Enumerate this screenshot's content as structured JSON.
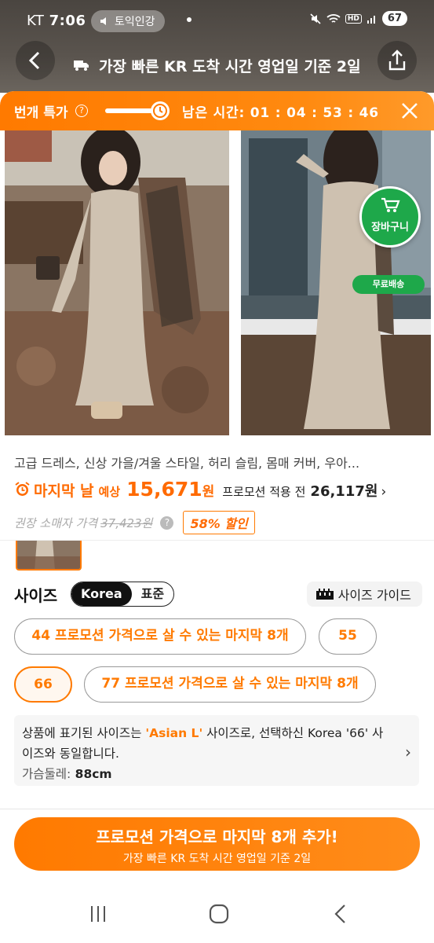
{
  "status_bar": {
    "carrier": "KT",
    "time": "7:06",
    "media_label": "토익인강",
    "hd_label": "HD",
    "battery": "67"
  },
  "banner": {
    "text": "가장 빠른 KR 도착 시간 영업일 기준 2일"
  },
  "promo": {
    "title": "번개 특가",
    "remaining_label": "남은 시간:",
    "remaining_time": "01 : 04 : 53 : 46",
    "progress_fraction": 0.85
  },
  "gallery": {
    "cart_label": "장바구니",
    "free_shipping_label": "무료배송"
  },
  "product": {
    "title": "고급 드레스, 신상 가을/겨울 스타일, 허리 슬림, 몸매 커버, 우아...",
    "last_day_label": "마지막 날",
    "expected_label": "예상",
    "price": "15,671",
    "currency": "원",
    "before_promo_label": "프로모션 적용 전",
    "before_promo_price": "26,117원",
    "msrp_label": "권장 소매자 가격",
    "msrp_price": "37,423원",
    "discount": "58% 할인"
  },
  "size_section": {
    "label": "사이즈",
    "toggle_options": [
      "Korea",
      "표준"
    ],
    "active_toggle": "Korea",
    "size_guide_label": "사이즈 가이드",
    "options": [
      {
        "size": "44",
        "note": "프로모션 가격으로 살 수 있는 마지막 8개"
      },
      {
        "size": "55",
        "note": ""
      },
      {
        "size": "66",
        "note": ""
      },
      {
        "size": "77",
        "note": "프로모션 가격으로 살 수 있는 마지막 8개"
      }
    ],
    "selected_size": "66",
    "note_prefix": "상품에 표기된 사이즈는 ",
    "note_highlight": "'Asian L'",
    "note_suffix": " 사이즈로, 선택하신 Korea '66' 사이즈와 동일합니다.",
    "chest_label": "가슴둘레:",
    "chest_value": " 88cm"
  },
  "cta": {
    "main": "프로모션 가격으로 마지막 8개 추가!",
    "sub": "가장 빠른 KR 도착 시간 영업일 기준 2일"
  },
  "colors": {
    "accent": "#ff7a00",
    "cart_green": "#1ea84a"
  }
}
